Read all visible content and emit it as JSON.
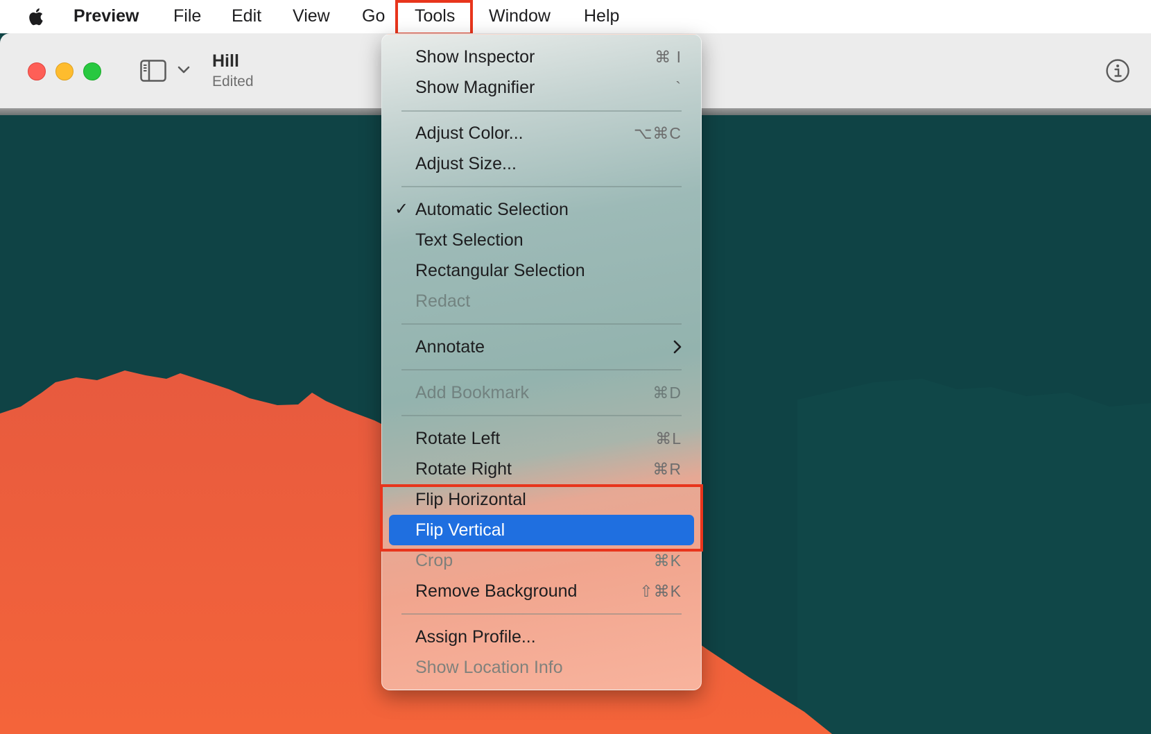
{
  "menubar": {
    "apple_icon": "apple-logo-icon",
    "app_name": "Preview",
    "items": [
      "File",
      "Edit",
      "View",
      "Go",
      "Tools",
      "Window",
      "Help"
    ],
    "highlighted_item": "Tools"
  },
  "window": {
    "title": "Hill",
    "subtitle": "Edited",
    "traffic_lights": [
      "close",
      "minimize",
      "maximize"
    ],
    "icons": [
      "sidebar-toggle-icon",
      "chevron-down-icon",
      "info-icon"
    ]
  },
  "tools_menu": {
    "items": [
      {
        "label": "Show Inspector",
        "shortcut": "⌘ I"
      },
      {
        "label": "Show Magnifier",
        "shortcut": "`"
      },
      {
        "label": "Adjust Color...",
        "shortcut": "⌥⌘C"
      },
      {
        "label": "Adjust Size..."
      },
      {
        "label": "Automatic Selection",
        "checked": true,
        "check_mark": "✓"
      },
      {
        "label": "Text Selection"
      },
      {
        "label": "Rectangular Selection"
      },
      {
        "label": "Redact",
        "disabled": true
      },
      {
        "label": "Annotate",
        "submenu": true
      },
      {
        "label": "Add Bookmark",
        "shortcut": "⌘D",
        "disabled": true
      },
      {
        "label": "Rotate Left",
        "shortcut": "⌘L"
      },
      {
        "label": "Rotate Right",
        "shortcut": "⌘R"
      },
      {
        "label": "Flip Horizontal"
      },
      {
        "label": "Flip Vertical",
        "selected": true
      },
      {
        "label": "Crop",
        "shortcut": "⌘K",
        "disabled": true
      },
      {
        "label": "Remove Background",
        "shortcut": "⇧⌘K"
      },
      {
        "label": "Assign Profile..."
      },
      {
        "label": "Show Location Info",
        "disabled": true
      }
    ]
  },
  "colors": {
    "highlight_red": "#e8351c",
    "selection_blue": "#1f6fe0",
    "canvas_teal": "#0f4345",
    "hill_orange": "#f0603c"
  }
}
